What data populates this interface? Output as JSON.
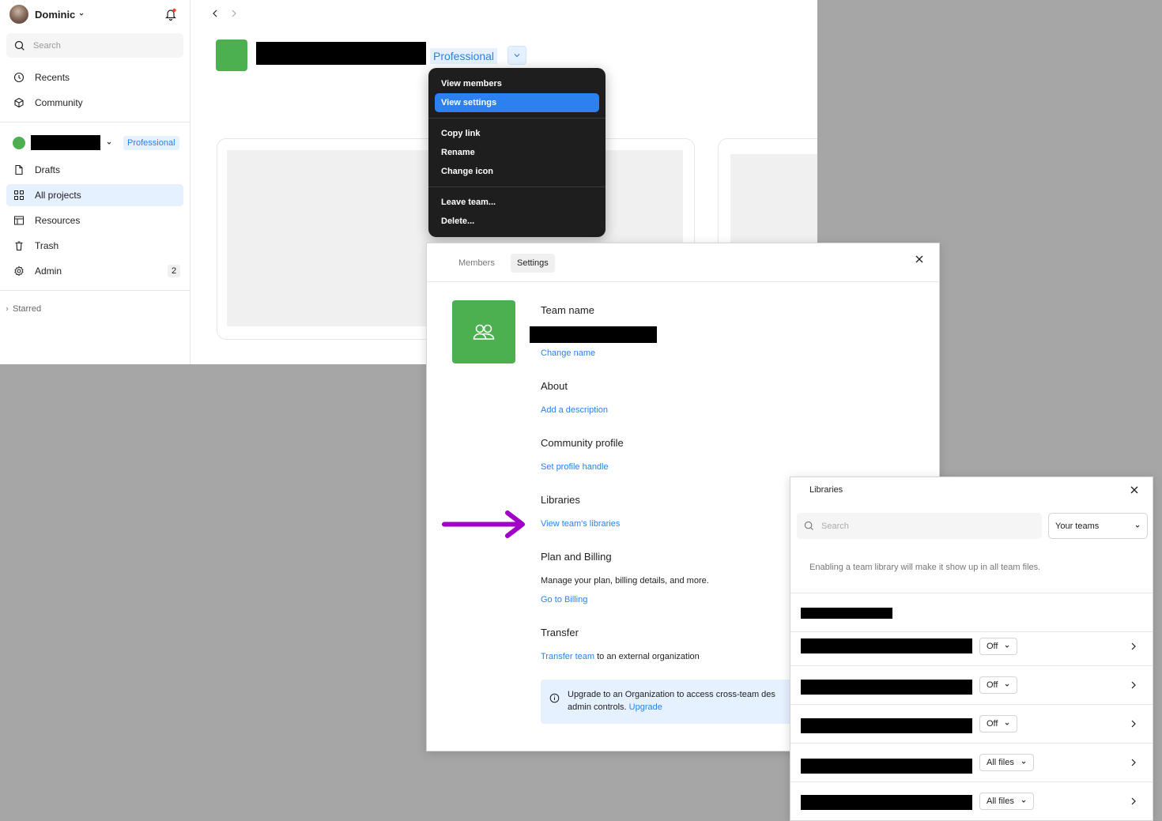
{
  "sidebar": {
    "user_name": "Dominic",
    "search_placeholder": "Search",
    "nav": [
      {
        "label": "Recents"
      },
      {
        "label": "Community"
      }
    ],
    "team": {
      "plan_badge": "Professional",
      "color": "#4caf50"
    },
    "team_nav": [
      {
        "label": "Drafts"
      },
      {
        "label": "All projects"
      },
      {
        "label": "Resources"
      },
      {
        "label": "Trash"
      },
      {
        "label": "Admin",
        "badge": "2"
      }
    ],
    "starred_label": "Starred"
  },
  "header": {
    "plan_label": "Professional",
    "team_color": "#4caf50"
  },
  "context_menu": {
    "items": [
      {
        "label": "View members"
      },
      {
        "label": "View settings",
        "highlighted": true
      },
      {
        "label": "Copy link"
      },
      {
        "label": "Rename"
      },
      {
        "label": "Change icon"
      },
      {
        "label": "Leave team..."
      },
      {
        "label": "Delete..."
      }
    ]
  },
  "settings": {
    "tabs": [
      {
        "label": "Members"
      },
      {
        "label": "Settings",
        "active": true
      }
    ],
    "team_name_heading": "Team name",
    "change_name_link": "Change name",
    "about_heading": "About",
    "add_description_link": "Add a description",
    "community_heading": "Community profile",
    "set_handle_link": "Set profile handle",
    "libraries_heading": "Libraries",
    "view_libraries_link": "View team's libraries",
    "billing_heading": "Plan and Billing",
    "billing_text": "Manage your plan, billing details, and more.",
    "billing_link": "Go to Billing",
    "transfer_heading": "Transfer",
    "transfer_link": "Transfer team",
    "transfer_text": "to an external organization",
    "upgrade_notice_line1": "Upgrade to an Organization to access cross-team des",
    "upgrade_notice_line2": "admin controls.",
    "upgrade_link": "Upgrade",
    "accent": "#2c80f0",
    "arrow_color": "#a100c7"
  },
  "libraries": {
    "title": "Libraries",
    "search_placeholder": "Search",
    "filter_label": "Your teams",
    "info_text": "Enabling a team library will make it show up in all team files.",
    "rows": [
      {
        "status": "Off"
      },
      {
        "status": "Off"
      },
      {
        "status": "Off"
      },
      {
        "status": "All files"
      },
      {
        "status": "All files"
      }
    ]
  }
}
